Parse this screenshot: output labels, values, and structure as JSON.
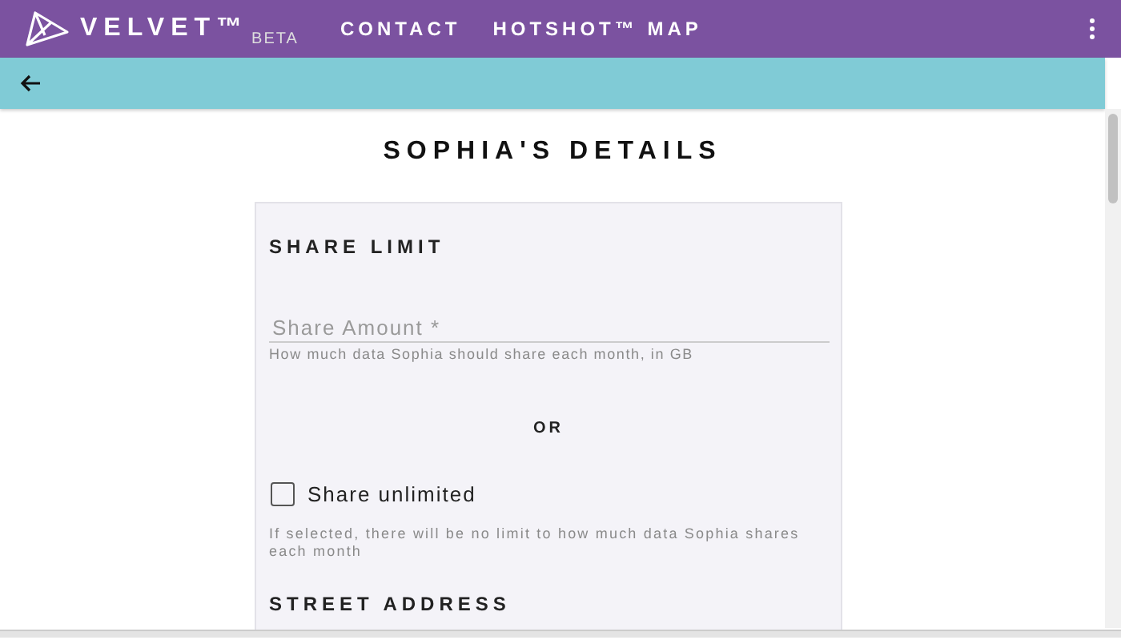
{
  "header": {
    "brand": "VELVET™",
    "badge": "BETA",
    "nav": [
      {
        "label": "CONTACT"
      },
      {
        "label": "HOTSHOT™ MAP"
      }
    ]
  },
  "page": {
    "title": "SOPHIA'S DETAILS"
  },
  "share_limit": {
    "heading": "SHARE LIMIT",
    "field": {
      "placeholder": "Share Amount *",
      "hint": "How much data Sophia should share each month, in GB"
    },
    "separator": "OR",
    "checkbox": {
      "label": "Share unlimited",
      "checked": false,
      "hint": "If selected, there will be no limit to how much data Sophia shares each month"
    }
  },
  "street_address": {
    "heading": "STREET ADDRESS"
  }
}
